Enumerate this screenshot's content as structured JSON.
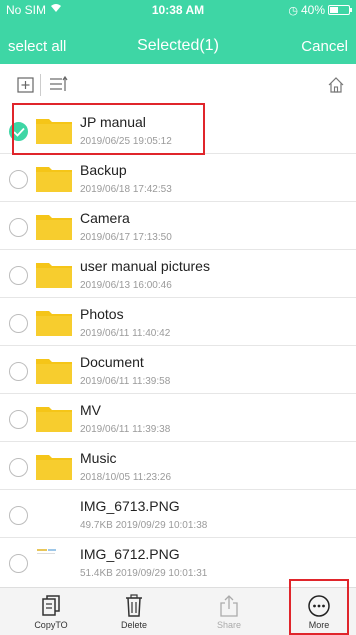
{
  "status_bar": {
    "carrier": "No SIM",
    "time": "10:38 AM",
    "battery": "40%",
    "battery_level": 0.4
  },
  "nav": {
    "select_all": "select all",
    "title": "Selected(1)",
    "cancel": "Cancel"
  },
  "items": [
    {
      "name": "JP manual",
      "meta": "2019/06/25 19:05:12",
      "selected": true,
      "type": "folder"
    },
    {
      "name": "Backup",
      "meta": "2019/06/18 17:42:53",
      "selected": false,
      "type": "folder"
    },
    {
      "name": "Camera",
      "meta": "2019/06/17 17:13:50",
      "selected": false,
      "type": "folder"
    },
    {
      "name": "user manual pictures",
      "meta": "2019/06/13 16:00:46",
      "selected": false,
      "type": "folder"
    },
    {
      "name": "Photos",
      "meta": "2019/06/11 11:40:42",
      "selected": false,
      "type": "folder"
    },
    {
      "name": "Document",
      "meta": "2019/06/11 11:39:58",
      "selected": false,
      "type": "folder"
    },
    {
      "name": "MV",
      "meta": "2019/06/11 11:39:38",
      "selected": false,
      "type": "folder"
    },
    {
      "name": "Music",
      "meta": "2018/10/05 11:23:26",
      "selected": false,
      "type": "folder"
    },
    {
      "name": "IMG_6713.PNG",
      "meta": "49.7KB 2019/09/29 10:01:38",
      "selected": false,
      "type": "image"
    },
    {
      "name": "IMG_6712.PNG",
      "meta": "51.4KB 2019/09/29 10:01:31",
      "selected": false,
      "type": "image"
    }
  ],
  "bottom_bar": {
    "copy_to": "CopyTO",
    "delete": "Delete",
    "share": "Share",
    "more": "More"
  },
  "colors": {
    "accent": "#3ed6a5",
    "folder": "#f5c518",
    "highlight": "#e0252b"
  }
}
